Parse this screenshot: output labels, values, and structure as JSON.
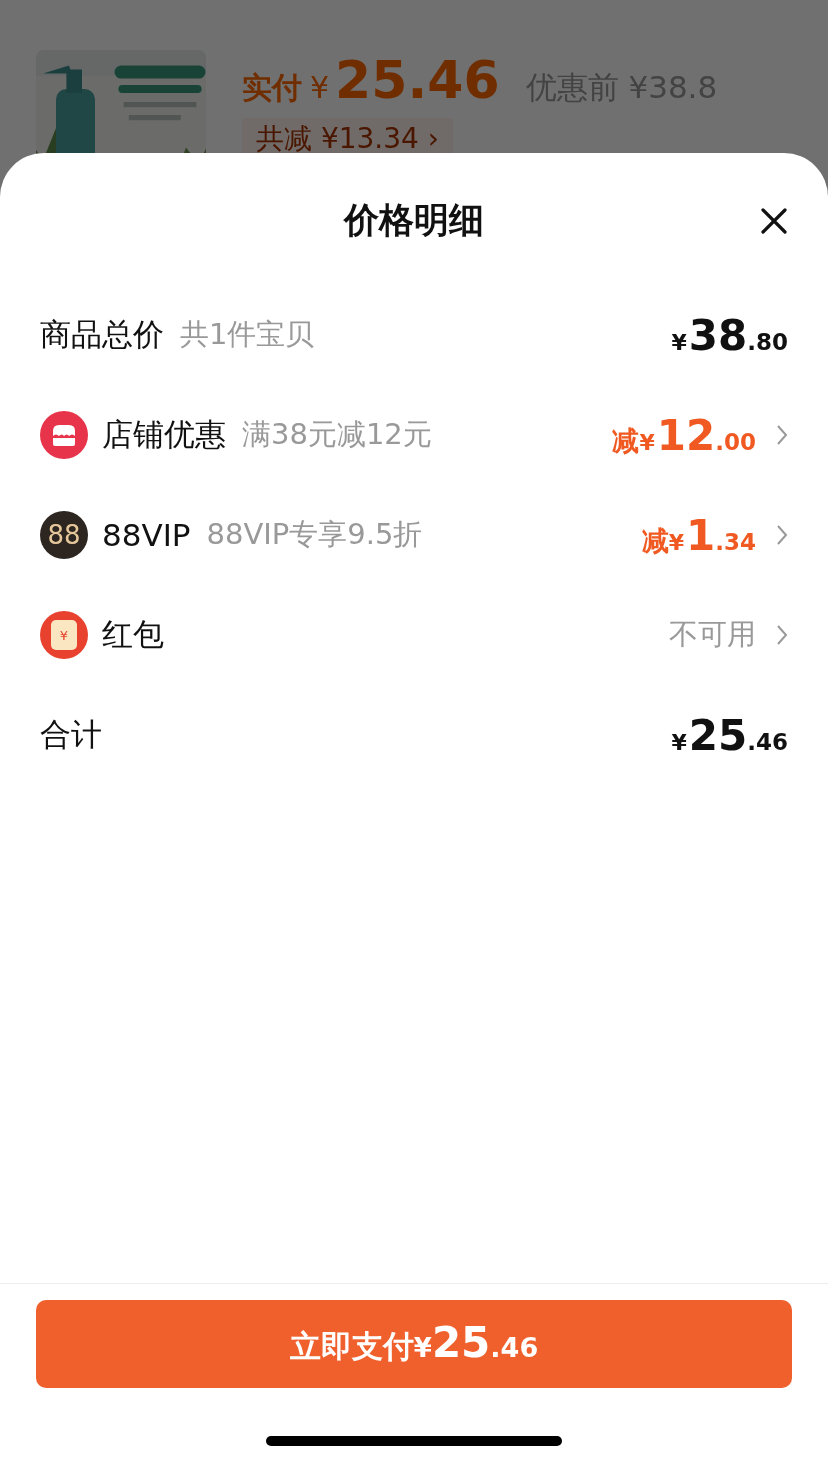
{
  "background": {
    "paid_label": "实付",
    "paid_price": "¥",
    "paid_amount": "25.46",
    "original": "优惠前 ¥38.8",
    "saved": "共减 ¥13.34 ›"
  },
  "sheet": {
    "title": "价格明细",
    "rows": [
      {
        "kind": "plain",
        "label": "商品总价",
        "note": "共1件宝贝",
        "price": {
          "currency": "¥",
          "integer": "38",
          "decimal": ".80"
        }
      },
      {
        "kind": "store",
        "label": "店铺优惠",
        "note": "满38元减12元",
        "price": {
          "prefix": "减",
          "currency": "¥",
          "integer": "12",
          "decimal": ".00"
        }
      },
      {
        "kind": "vip",
        "icon_text": "88",
        "label": "88VIP",
        "note": "88VIP专享9.5折",
        "price": {
          "prefix": "减",
          "currency": "¥",
          "integer": "1",
          "decimal": ".34"
        }
      },
      {
        "kind": "packet",
        "icon_text": "¥",
        "label": "红包",
        "status": "不可用"
      },
      {
        "kind": "plain",
        "label": "合计",
        "price": {
          "currency": "¥",
          "integer": "25",
          "decimal": ".46"
        }
      }
    ],
    "pay_button": {
      "label": "立即支付",
      "currency": "¥",
      "integer": "25",
      "decimal": ".46"
    }
  }
}
